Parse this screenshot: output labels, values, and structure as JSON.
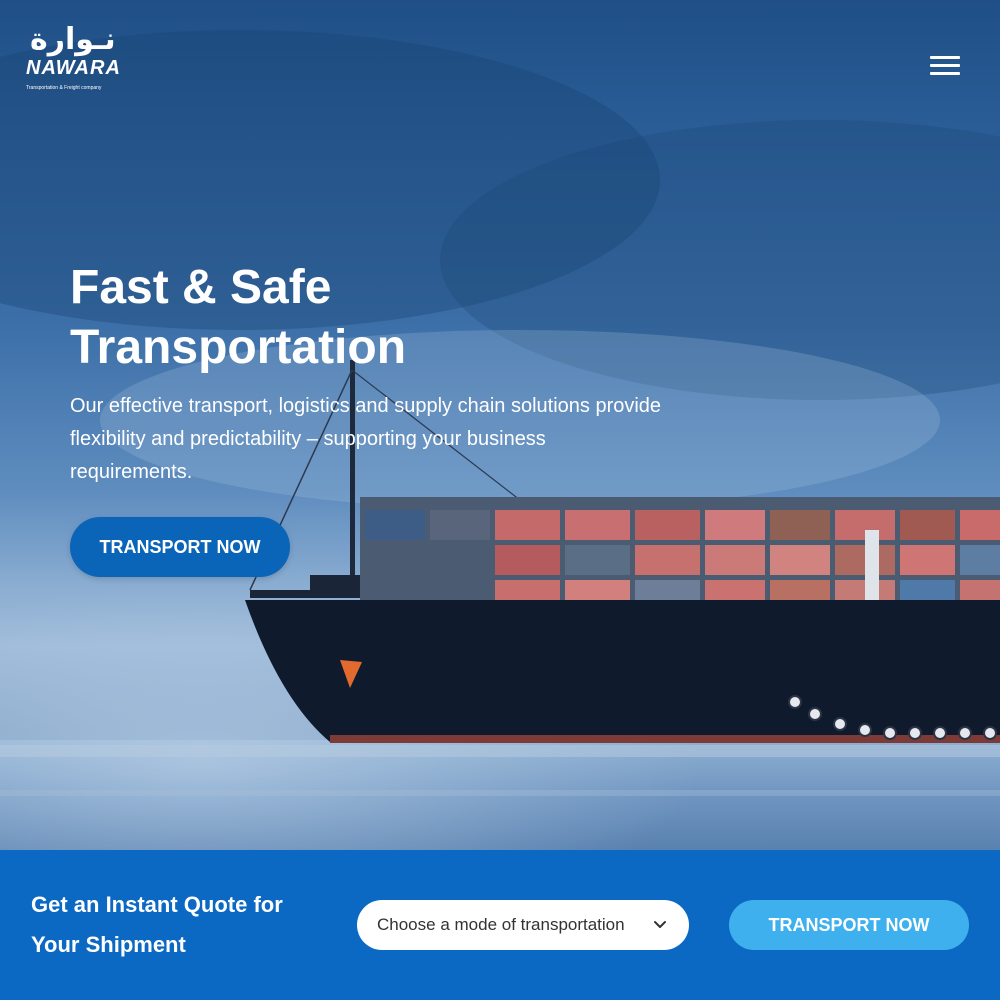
{
  "brand": {
    "logo_arabic": "نـوارة",
    "logo_name": "NAWARA",
    "tagline": "Transportation & Freight company"
  },
  "header": {
    "menu_icon": "hamburger-menu-icon"
  },
  "hero": {
    "title_line1": "Fast & Safe",
    "title_line2": "Transportation",
    "description": "Our effective transport, logistics and supply chain solutions provide flexibility and predictability – supporting your business requirements.",
    "cta_label": "TRANSPORT NOW"
  },
  "quote": {
    "title": "Get an Instant Quote for Your Shipment",
    "select_value": "Choose a mode of transportation",
    "select_icon": "chevron-down-icon",
    "cta_label": "TRANSPORT NOW"
  },
  "colors": {
    "primary_blue": "#0a64b8",
    "quote_bar": "#0b69c4",
    "light_blue_button": "#3fb0ee",
    "white": "#ffffff"
  }
}
